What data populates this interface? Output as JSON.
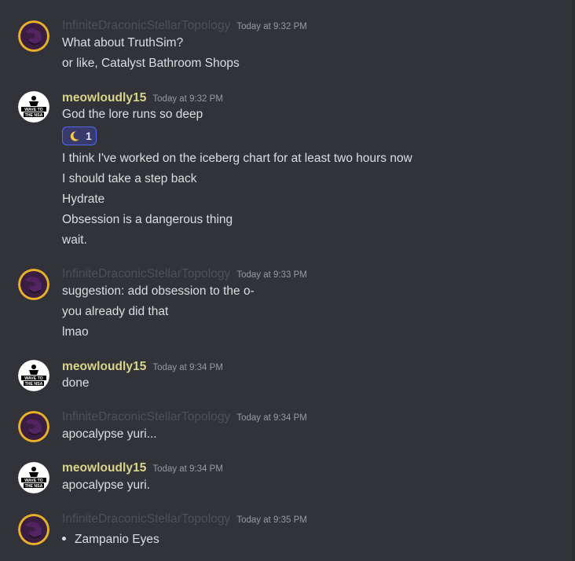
{
  "users": {
    "infinite": "InfiniteDraconicStellarTopology",
    "meow": "meowloudly15",
    "meow_avatar_text": [
      "WAVE TO",
      "THE NSA"
    ]
  },
  "colors": {
    "background": "#313338",
    "infinite_name": "#4e5058",
    "meow_name": "#d8d58c",
    "reaction_bg": "#373a6a",
    "reaction_border": "#5865f2"
  },
  "groups": [
    {
      "author": "InfiniteDraconicStellarTopology",
      "timestamp": "Today at 9:32 PM",
      "lines": [
        "What about TruthSim?",
        "or like, Catalyst Bathroom Shops"
      ]
    },
    {
      "author": "meowloudly15",
      "timestamp": "Today at 9:32 PM",
      "lines": [
        "God the lore runs so deep"
      ],
      "reaction": {
        "icon": "crescent-moon-icon",
        "count": "1"
      },
      "lines_after_reaction": [
        "I think I've worked on the iceberg chart for at least two hours now",
        "I should take a step back",
        "Hydrate",
        "Obsession is a dangerous thing",
        "wait."
      ]
    },
    {
      "author": "InfiniteDraconicStellarTopology",
      "timestamp": "Today at 9:33 PM",
      "lines": [
        "suggestion: add obsession to the o-",
        "you already did that",
        "lmao"
      ]
    },
    {
      "author": "meowloudly15",
      "timestamp": "Today at 9:34 PM",
      "lines": [
        "done"
      ]
    },
    {
      "author": "InfiniteDraconicStellarTopology",
      "timestamp": "Today at 9:34 PM",
      "lines": [
        "apocalypse yuri..."
      ]
    },
    {
      "author": "meowloudly15",
      "timestamp": "Today at 9:34 PM",
      "lines": [
        "apocalypse yuri."
      ]
    },
    {
      "author": "InfiniteDraconicStellarTopology",
      "timestamp": "Today at 9:35 PM",
      "bullets": [
        "Zampanio Eyes"
      ]
    }
  ]
}
